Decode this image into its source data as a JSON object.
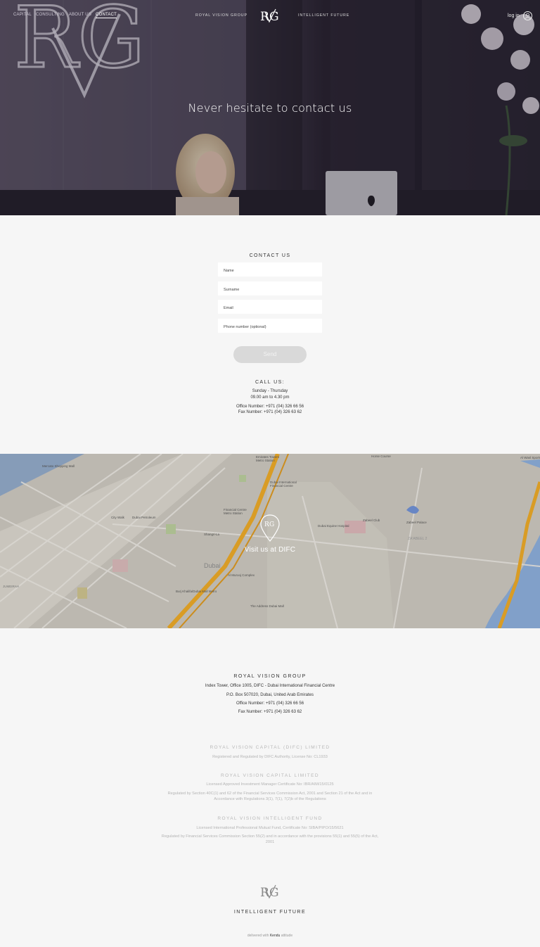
{
  "nav": {
    "links": [
      {
        "label": "CAPITAL"
      },
      {
        "label": "CONSULTING"
      },
      {
        "label": "ABOUT US"
      },
      {
        "label": "CONTACT",
        "active": true
      }
    ],
    "brand_left": "ROYAL VISION GROUP",
    "brand_right": "INTELLIGENT FUTURE",
    "login_label": "log in"
  },
  "hero": {
    "title": "Never hesitate to contact us"
  },
  "contact": {
    "title": "CONTACT US",
    "fields": [
      {
        "placeholder": "Name"
      },
      {
        "placeholder": "Surname"
      },
      {
        "placeholder": "Email"
      },
      {
        "placeholder": "Phone number (optional)"
      }
    ],
    "send_label": "Send",
    "call_title": "CALL US:",
    "days": "Sunday - Thursday",
    "hours": "09.00 am to 4.30 pm",
    "office": "Office Number: +971 (04) 326 66 56",
    "fax": "Fax Number: +971 (04) 326 63 62"
  },
  "map": {
    "label": "Visit us at DIFC",
    "place_labels": [
      "Mercato Shopping Mall",
      "City Walk",
      "Dubai Petroleum",
      "Shangri-La",
      "Financial Centre Metro Station",
      "Emirates Towers Metro Station",
      "Dubai International Financial Centre",
      "Dubai Equine Hospital",
      "Zabeel Club",
      "Zabeel Palace",
      "ZA'ABEEL 2",
      "Al Wasl Sports",
      "Horse Course",
      "Dubai",
      "Al Murooj Complex",
      "Burj Khalifa/Dubai Mall Metro",
      "The Address Dubai Mall",
      "JUMEIRAH"
    ]
  },
  "footer": {
    "group_title": "ROYAL VISION GROUP",
    "address": "Index Tower, Office 1005, DIFC - Dubai International Financial Centre",
    "po_box": "P.O. Box 507020, Dubai, United Arab Emirates",
    "office": "Office Number: +971 (04) 326 66 56",
    "fax": "Fax Number: +971 (04) 326 63 62",
    "entities": [
      {
        "title": "ROYAL VISION CAPITAL (DIFC) LIMITED",
        "lines": [
          "Registered and Regulated by DIFC Authority, License No: CL1933"
        ]
      },
      {
        "title": "ROYAL VISION CAPITAL LIMITED",
        "lines": [
          "Licensed Approved Investment Manager Certificate No: IBR/AIM/15/0125",
          "Regulated by Section 40C(1) and 62 of the Financial Services Commission Act, 2001 and Section 21 of the Act and in Accordance with Regulations 3(1), 7(1), 7(2)b of the Regulations"
        ]
      },
      {
        "title": "ROYAL VISION INTELLIGENT FUND",
        "lines": [
          "Licensed International Professional Mutual Fund, Certificate No: SIBA/PIPO/15/5621",
          "Regulated by Financial Services Commission Section 55(2) and in accordance with the provisions 55(1) and 55(5) of the Act, 2001"
        ]
      }
    ],
    "tagline": "INTELLIGENT FUTURE",
    "credit_prefix": "delivered with",
    "credit_brand": "Kendu",
    "credit_suffix": "attitude"
  }
}
